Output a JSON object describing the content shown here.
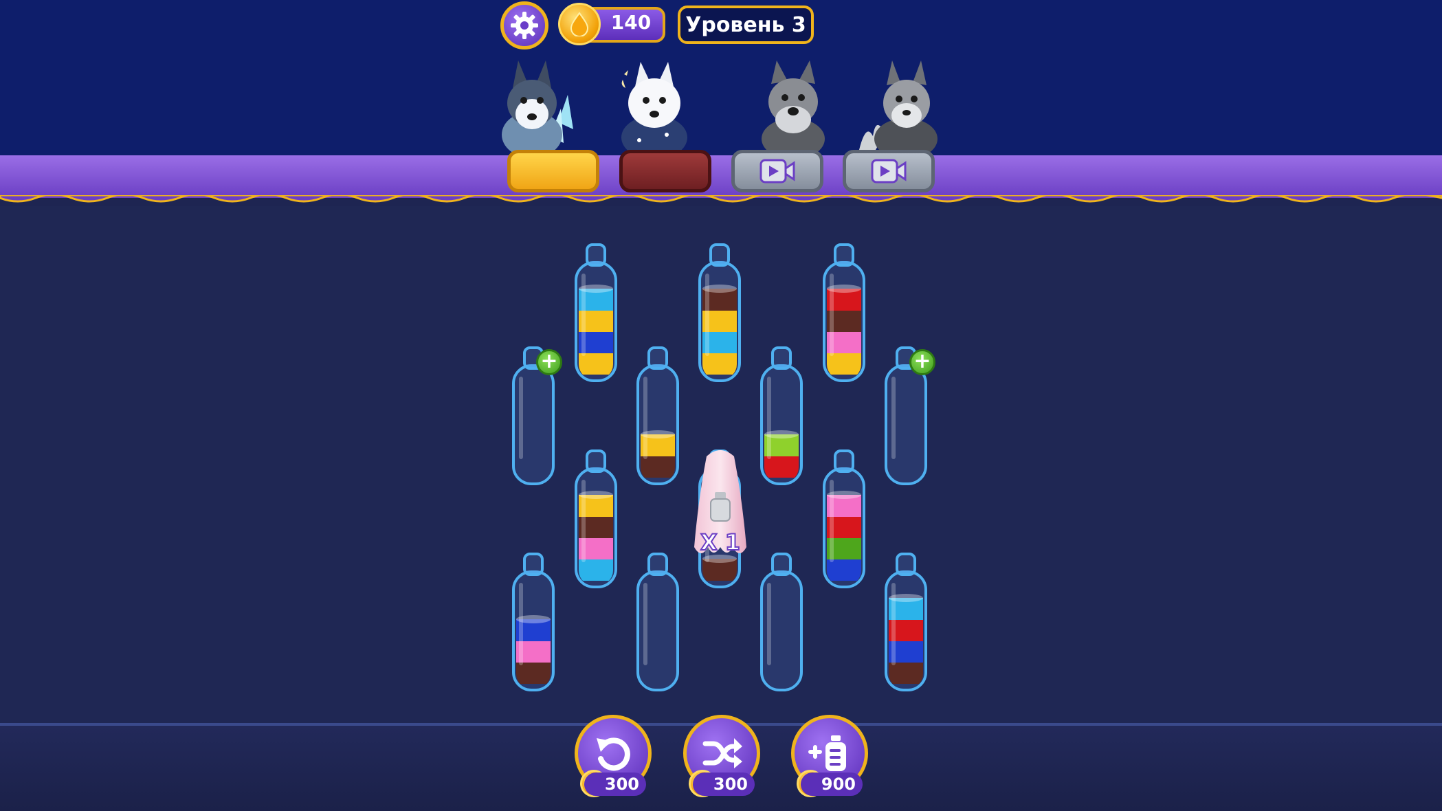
{
  "hud": {
    "coins": "140",
    "level": "Уровень 3",
    "icons": {
      "settings": "gear-icon",
      "currency": "coin-icon"
    }
  },
  "collection": {
    "characters": [
      {
        "name": "husky-dog",
        "unlocked": true,
        "pedestal": "gold"
      },
      {
        "name": "samoyed-dog",
        "unlocked": true,
        "pedestal": "brown"
      },
      {
        "name": "schnauzer-dog",
        "unlocked": false,
        "pedestal": "video"
      },
      {
        "name": "shiba-dog",
        "unlocked": false,
        "pedestal": "video"
      }
    ]
  },
  "colors": {
    "light-blue": "#2bb3ea",
    "yellow": "#f6c21a",
    "blue": "#1f3fd1",
    "brown": "#5c2a22",
    "red": "#d7161c",
    "pink": "#f46fc7",
    "green": "#4ea61c",
    "lime": "#8fd12c"
  },
  "bottles": [
    {
      "id": "b1",
      "layers_top_to_bottom": [
        "light-blue",
        "yellow",
        "blue",
        "yellow"
      ]
    },
    {
      "id": "b2",
      "layers_top_to_bottom": [
        "brown",
        "yellow",
        "light-blue",
        "yellow"
      ]
    },
    {
      "id": "b3",
      "layers_top_to_bottom": [
        "red",
        "brown",
        "pink",
        "yellow"
      ]
    },
    {
      "id": "b4",
      "layers_top_to_bottom": [],
      "add_button": true
    },
    {
      "id": "b5",
      "layers_top_to_bottom": [
        "yellow",
        "brown"
      ]
    },
    {
      "id": "b6",
      "layers_top_to_bottom": [
        "lime",
        "red"
      ]
    },
    {
      "id": "b7",
      "layers_top_to_bottom": [],
      "add_button": true
    },
    {
      "id": "b8",
      "layers_top_to_bottom": [
        "yellow",
        "brown",
        "pink",
        "light-blue"
      ]
    },
    {
      "id": "b9",
      "layers_top_to_bottom": [
        "brown"
      ],
      "locked": true
    },
    {
      "id": "b10",
      "layers_top_to_bottom": [
        "pink",
        "red",
        "green",
        "blue"
      ]
    },
    {
      "id": "b11",
      "layers_top_to_bottom": [
        "blue",
        "pink",
        "brown"
      ]
    },
    {
      "id": "b12",
      "layers_top_to_bottom": []
    },
    {
      "id": "b13",
      "layers_top_to_bottom": []
    },
    {
      "id": "b14",
      "layers_top_to_bottom": [
        "light-blue",
        "red",
        "blue",
        "brown"
      ]
    }
  ],
  "locked_bottle": {
    "count_label": "X 1"
  },
  "boosters": {
    "undo": {
      "icon": "undo-icon",
      "price": "300"
    },
    "shuffle": {
      "icon": "shuffle-icon",
      "price": "300"
    },
    "add_bottle": {
      "icon": "add-bottle-icon",
      "price": "900"
    }
  }
}
